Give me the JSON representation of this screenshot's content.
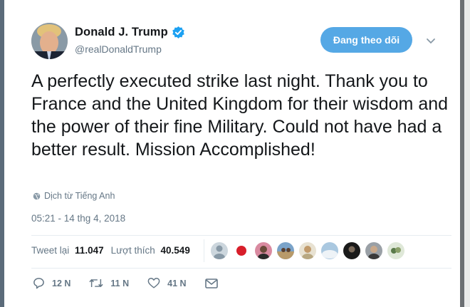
{
  "tweet": {
    "display_name": "Donald J. Trump",
    "handle": "@realDonaldTrump",
    "follow_label": "Đang theo dõi",
    "text": "A perfectly executed strike last night. Thank you to France and the United Kingdom for their wisdom and the power of their fine Military. Could not have had a better result. Mission Accomplished!",
    "translate_label": "Dịch từ Tiếng Anh",
    "timestamp": "05:21 - 14 thg 4, 2018",
    "retweets_label": "Tweet lại",
    "retweets_count": "11.047",
    "likes_label": "Lượt thích",
    "likes_count": "40.549",
    "actions": {
      "reply_count": "12 N",
      "retweet_count": "11 N",
      "like_count": "41 N"
    }
  },
  "icons": [
    "verified-badge-icon",
    "chevron-down-icon",
    "globe-icon",
    "reply-icon",
    "retweet-icon",
    "like-heart-icon",
    "direct-message-icon"
  ],
  "colors": {
    "accent": "#55a8e5",
    "text": "#14171a",
    "secondary_text": "#657786"
  }
}
